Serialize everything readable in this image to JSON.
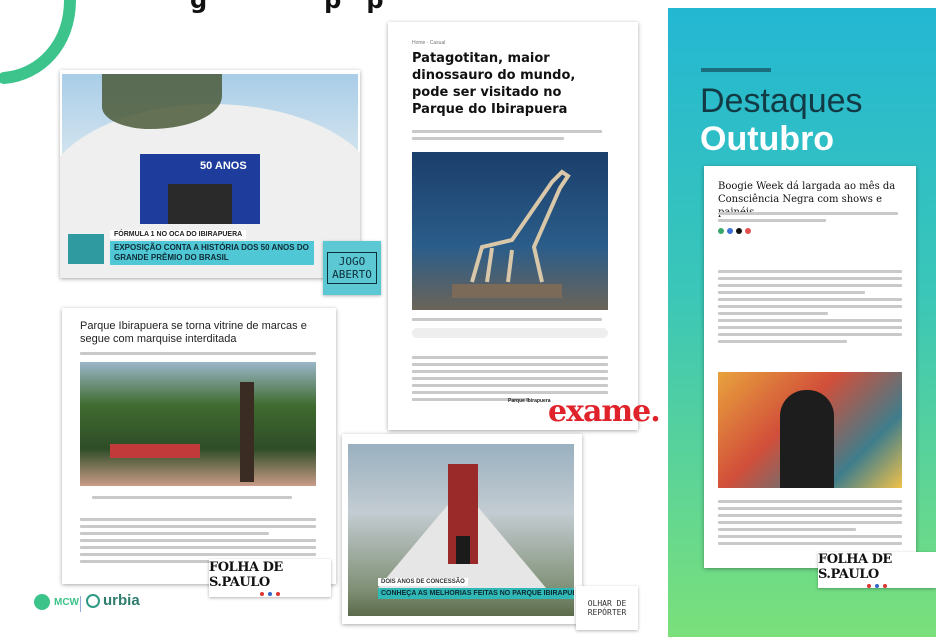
{
  "page": {
    "title_partial": "g              p   p"
  },
  "panel": {
    "title_line1": "Destaques",
    "title_line2": "Outubro",
    "gradient_top": "#24b7d3",
    "gradient_bottom": "#7be07a"
  },
  "cards": {
    "tv_expo": {
      "lower_third_small": "FÓRMULA 1 NO OCA DO IBIRAPUERA",
      "lower_third_main": "EXPOSIÇÃO CONTA A HISTÓRIA DOS 50 ANOS DO GRANDE PRÊMIO DO BRASIL",
      "bug_text": "JOGO ABERTO",
      "banner_text": "50 ANOS"
    },
    "exame": {
      "breadcrumb": "Home · Casual",
      "headline": "Patagotitan, maior dinossauro do mundo, pode ser visitado no Parque do Ibirapuera",
      "body_link": "Parque Ibirapuera"
    },
    "folha_park": {
      "headline": "Parque Ibirapuera se torna vitrine de marcas e segue com marquise interditada"
    },
    "tv_oca": {
      "lower_third_small": "DOIS ANOS DE CONCESSÃO",
      "lower_third_main": "CONHEÇA AS MELHORIAS FEITAS NO PARQUE IBIRAPUERA"
    },
    "folha_boogie": {
      "headline": "Boogie Week dá largada ao mês da Consciência Negra com shows e painéis"
    }
  },
  "logos": {
    "jogo_aberto": "JOGO ABERTO",
    "exame": "exame.",
    "folha_1": "FOLHA DE S.PAULO",
    "folha_2": "FOLHA DE S.PAULO",
    "olhar": "OLHAR DE REPÓRTER",
    "mcw": "MCW",
    "urbia": "urbia"
  }
}
